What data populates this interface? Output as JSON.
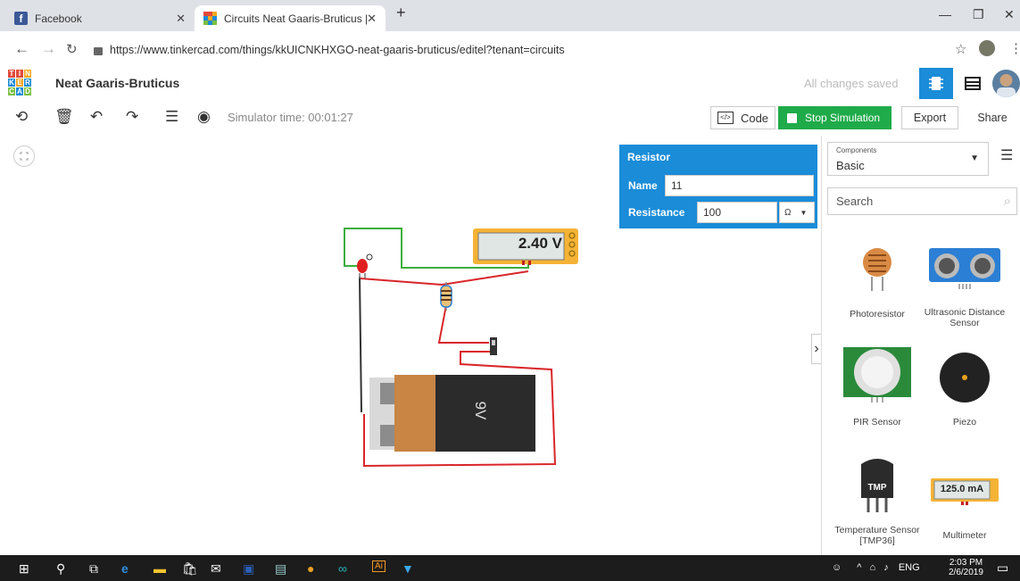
{
  "browser": {
    "tabs": [
      {
        "title": "Facebook",
        "favicon": "facebook-icon"
      },
      {
        "title": "Circuits Neat Gaaris-Bruticus | Tin",
        "favicon": "tinkercad-icon"
      }
    ],
    "url": "https://www.tinkercad.com/things/kkUICNKHXGO-neat-gaaris-bruticus/editel?tenant=circuits"
  },
  "app": {
    "logo_letters": [
      "T",
      "I",
      "N",
      "K",
      "E",
      "R",
      "C",
      "A",
      "D"
    ],
    "project_name": "Neat Gaaris-Bruticus",
    "save_status": "All changes saved",
    "accent": "#1a8cd8"
  },
  "toolbar": {
    "sim_time": "Simulator time: 00:01:27",
    "code_label": "Code",
    "stop_label": "Stop Simulation",
    "export_label": "Export",
    "share_label": "Share"
  },
  "inspector": {
    "title": "Resistor",
    "name_label": "Name",
    "name_value": "11",
    "resistance_label": "Resistance",
    "resistance_value": "100",
    "unit": "Ω"
  },
  "circuit": {
    "multimeter_reading": "2.40 V",
    "battery_label": "9V"
  },
  "panel": {
    "components_caption": "Components",
    "components_value": "Basic",
    "search_placeholder": "Search",
    "items": [
      {
        "label": "Photoresistor"
      },
      {
        "label": "Ultrasonic Distance Sensor"
      },
      {
        "label": "PIR Sensor"
      },
      {
        "label": "Piezo"
      },
      {
        "label": "Temperature Sensor [TMP36]"
      },
      {
        "label": "Multimeter"
      }
    ],
    "tmp_chip": "TMP",
    "multimeter_thumb": "125.0 mA"
  },
  "taskbar": {
    "tray_lang": "ENG",
    "time": "2:03 PM",
    "date": "2/6/2019"
  }
}
